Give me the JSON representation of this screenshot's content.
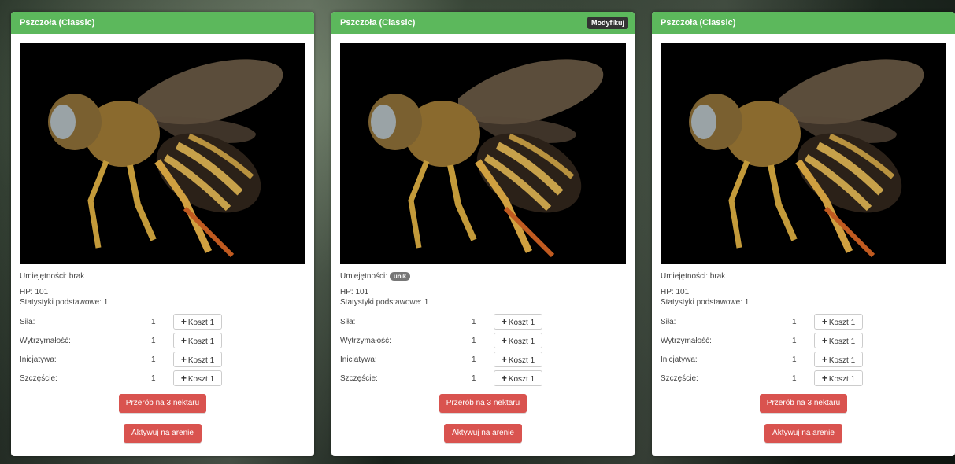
{
  "colors": {
    "header": "#5cb85c",
    "danger": "#d9534f",
    "badge": "#777777",
    "modify": "#333333"
  },
  "icons": {
    "cost": "plus-icon"
  },
  "cards": [
    {
      "title": "Pszczoła (Classic)",
      "skills_label": "Umiejętności: brak",
      "hp": "HP: 101",
      "base_stats": "Statystyki podstawowe: 1",
      "stats": [
        {
          "label": "Siła:",
          "value": "1",
          "cost": "Koszt 1"
        },
        {
          "label": "Wytrzymałość:",
          "value": "1",
          "cost": "Koszt 1"
        },
        {
          "label": "Inicjatywa:",
          "value": "1",
          "cost": "Koszt 1"
        },
        {
          "label": "Szczęście:",
          "value": "1",
          "cost": "Koszt 1"
        }
      ],
      "convert_label": "Przerób na 3 nektaru",
      "activate_label": "Aktywuj na arenie"
    },
    {
      "title": "Pszczoła (Classic)",
      "modify_label": "Modyfikuj",
      "skills_label": "Umiejętności:",
      "skill_badge": "unik",
      "hp": "HP: 101",
      "base_stats": "Statystyki podstawowe: 1",
      "stats": [
        {
          "label": "Siła:",
          "value": "1",
          "cost": "Koszt 1"
        },
        {
          "label": "Wytrzymałość:",
          "value": "1",
          "cost": "Koszt 1"
        },
        {
          "label": "Inicjatywa:",
          "value": "1",
          "cost": "Koszt 1"
        },
        {
          "label": "Szczęście:",
          "value": "1",
          "cost": "Koszt 1"
        }
      ],
      "convert_label": "Przerób na 3 nektaru",
      "activate_label": "Aktywuj na arenie"
    },
    {
      "title": "Pszczoła (Classic)",
      "skills_label": "Umiejętności: brak",
      "hp": "HP: 101",
      "base_stats": "Statystyki podstawowe: 1",
      "stats": [
        {
          "label": "Siła:",
          "value": "1",
          "cost": "Koszt 1"
        },
        {
          "label": "Wytrzymałość:",
          "value": "1",
          "cost": "Koszt 1"
        },
        {
          "label": "Inicjatywa:",
          "value": "1",
          "cost": "Koszt 1"
        },
        {
          "label": "Szczęście:",
          "value": "1",
          "cost": "Koszt 1"
        }
      ],
      "convert_label": "Przerób na 3 nektaru",
      "activate_label": "Aktywuj na arenie"
    }
  ]
}
